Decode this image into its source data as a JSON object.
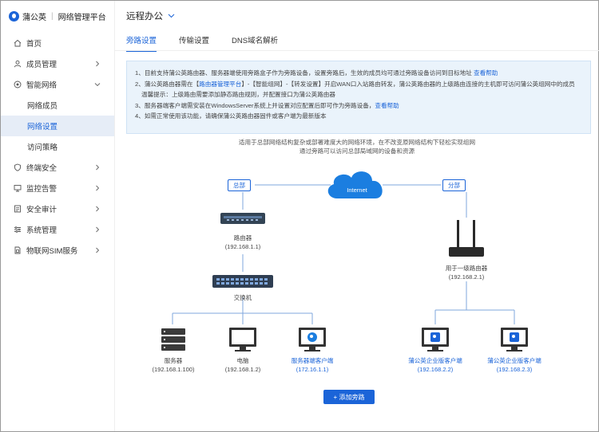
{
  "brand": {
    "name": "蒲公英",
    "product": "网络管理平台"
  },
  "sidebar": {
    "items": [
      {
        "label": "首页",
        "icon": "home-icon",
        "chevron": false
      },
      {
        "label": "成员管理",
        "icon": "user-icon",
        "chevron": true
      },
      {
        "label": "智能网络",
        "icon": "network-icon",
        "chevron": true,
        "expanded": true
      },
      {
        "label": "网络成员",
        "sub": true
      },
      {
        "label": "网络设置",
        "sub": true,
        "active": true
      },
      {
        "label": "访问策略",
        "sub": true
      },
      {
        "label": "终端安全",
        "icon": "shield-icon",
        "chevron": true
      },
      {
        "label": "监控告警",
        "icon": "monitor-icon",
        "chevron": true
      },
      {
        "label": "安全审计",
        "icon": "audit-icon",
        "chevron": true
      },
      {
        "label": "系统管理",
        "icon": "settings-icon",
        "chevron": true
      },
      {
        "label": "物联网SIM服务",
        "icon": "sim-icon",
        "chevron": true
      }
    ]
  },
  "header": {
    "title": "远程办公"
  },
  "tabs": [
    {
      "label": "旁路设置",
      "active": true
    },
    {
      "label": "传输设置"
    },
    {
      "label": "DNS域名解析"
    }
  ],
  "info": {
    "l1": "1、目前支持蒲公英路由器、服务器端使用旁路盒子作为旁路设备，设置旁路后，生效的成员均可通过旁路设备访问到目标地址 ",
    "l1_link": "查看帮助",
    "l2a": "2、蒲公英路由器需在【",
    "l2_link": "路由器管理平台",
    "l2b": "】-【智能组网】-【转发设置】开启WAN口入站路由转发，蒲公英路由器的上级路由连接的主机即可访问蒲公英组网中的成员",
    "l3": "温馨提示：上级路由需要添加静态路由规则，并配置接口为蒲公英路由器",
    "l4": "3、服务器端客户端需安装在WindowsServer系统上并设置对应配置后即可作为旁路设备，",
    "l4_link": "查看帮助",
    "l5": "4、如需正常使用该功能，请确保蒲公英路由器固件或客户端为最新版本"
  },
  "diagram": {
    "desc1": "适用于总部网络结构复杂或部署难度大的网络环境，在不改变原网络结构下轻松实现组网",
    "desc2": "通过旁路可以访问总部局域网的设备和资源",
    "internet": "Internet",
    "hq_tag": "总部",
    "branch_tag": "分部",
    "router": {
      "name": "路由器",
      "ip": "(192.168.1.1)"
    },
    "switch": {
      "name": "交换机"
    },
    "upper_router": {
      "name": "用于一级路由器",
      "ip": "(192.168.2.1)"
    },
    "server": {
      "name": "服务器",
      "ip": "(192.168.1.100)"
    },
    "pc": {
      "name": "电脑",
      "ip": "(192.168.1.2)"
    },
    "server_client": {
      "name": "服务器端客户端",
      "ip": "(172.16.1.1)"
    },
    "ent_client1": {
      "name": "蒲公英企业版客户端",
      "ip": "(192.168.2.2)"
    },
    "ent_client2": {
      "name": "蒲公英企业版客户端",
      "ip": "(192.168.2.3)"
    },
    "add_button": "+ 添加旁路"
  },
  "colors": {
    "accent": "#1b64d8",
    "info_bg": "#eaf3fb",
    "active_bg": "#e6edf7"
  }
}
